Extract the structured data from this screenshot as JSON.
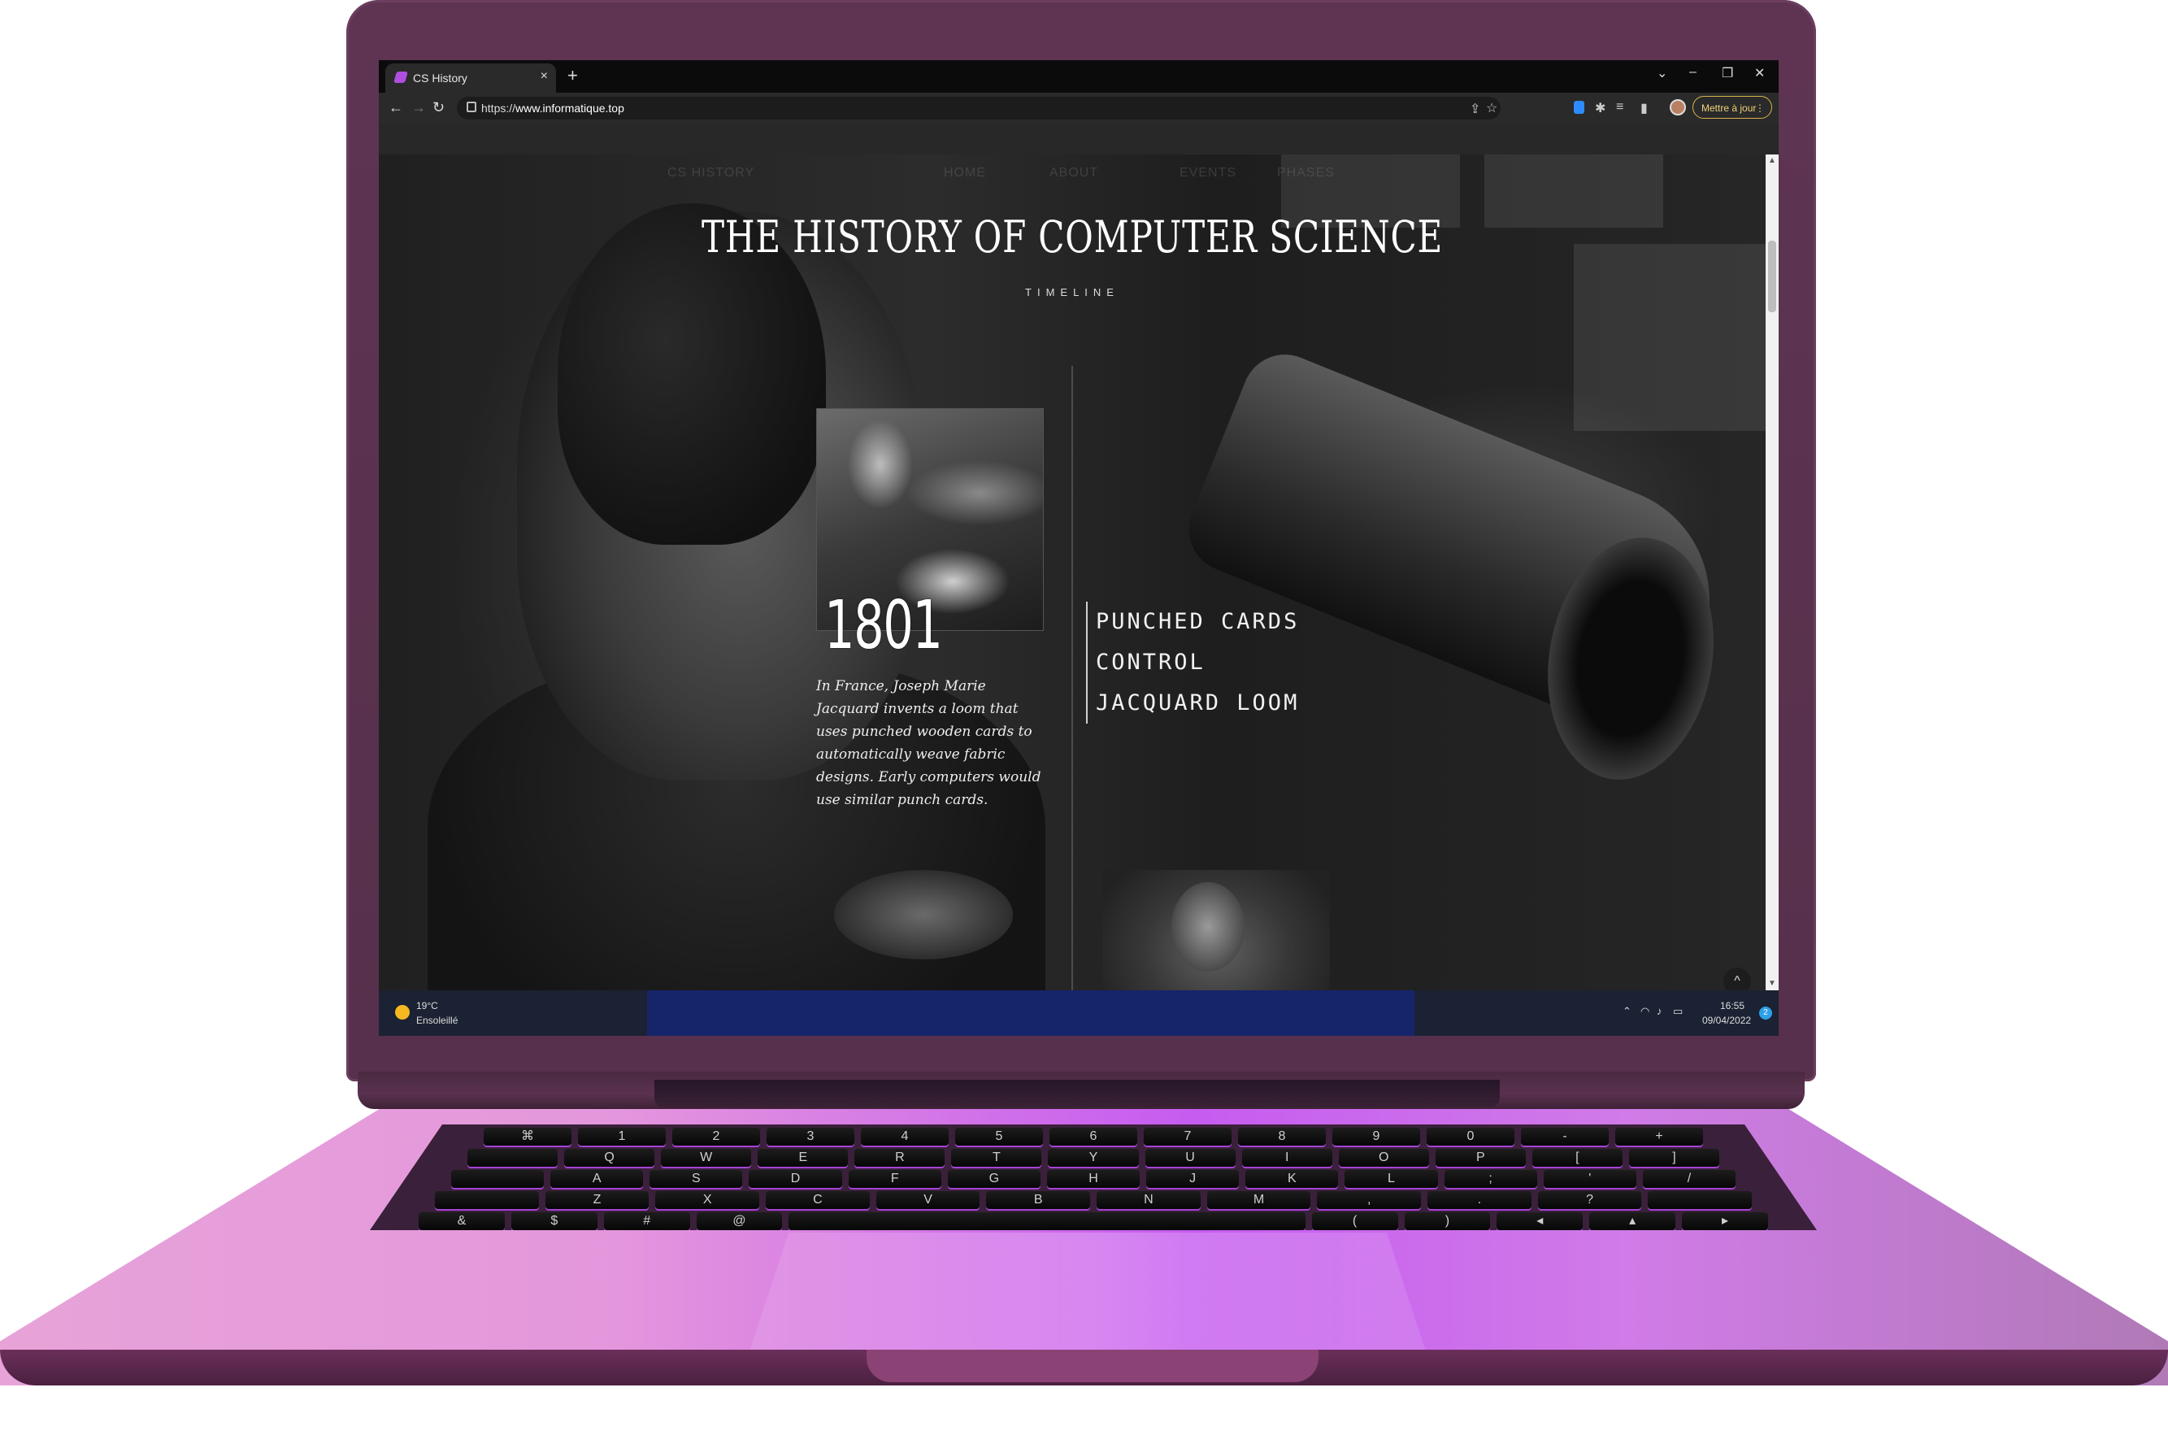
{
  "browser": {
    "tab_title": "CS History",
    "tab_close": "×",
    "new_tab": "+",
    "url_prefix": "https://",
    "url_host": "www.informatique.top",
    "update_button": "Mettre à jour",
    "window_controls": [
      "⌄",
      "–",
      "❐",
      "✕"
    ]
  },
  "page": {
    "nav": {
      "brand": "CS HISTORY",
      "items": [
        "HOME",
        "ABOUT",
        "EVENTS",
        "PHASES"
      ]
    },
    "title": "THE HISTORY OF COMPUTER SCIENCE",
    "subtitle": "TIMELINE",
    "event": {
      "year": "1801",
      "description": "In France, Joseph Marie Jacquard invents a loom that uses punched wooden cards to automatically weave fabric designs. Early computers would use similar punch cards.",
      "tags": [
        "PUNCHED CARDS",
        "CONTROL",
        "JACQUARD LOOM"
      ]
    },
    "scroll_top": "^"
  },
  "taskbar": {
    "temperature": "19°C",
    "condition": "Ensoleillé",
    "time": "16:55",
    "date": "09/04/2022",
    "notifications": "2"
  },
  "keyboard": {
    "row1": [
      "⌘",
      "1",
      "2",
      "3",
      "4",
      "5",
      "6",
      "7",
      "8",
      "9",
      "0",
      "-",
      "+"
    ],
    "row2": [
      "Q",
      "W",
      "E",
      "R",
      "T",
      "Y",
      "U",
      "I",
      "O",
      "P",
      "[",
      "]"
    ],
    "row3": [
      "A",
      "S",
      "D",
      "F",
      "G",
      "H",
      "J",
      "K",
      "L",
      ";",
      "'",
      "/"
    ],
    "row4": [
      "Z",
      "X",
      "C",
      "V",
      "B",
      "N",
      "M",
      ",",
      ".",
      "?"
    ],
    "row5": [
      "&",
      "$",
      "#",
      "@",
      "",
      "(",
      ")",
      "◂",
      "▴",
      "▸"
    ]
  }
}
